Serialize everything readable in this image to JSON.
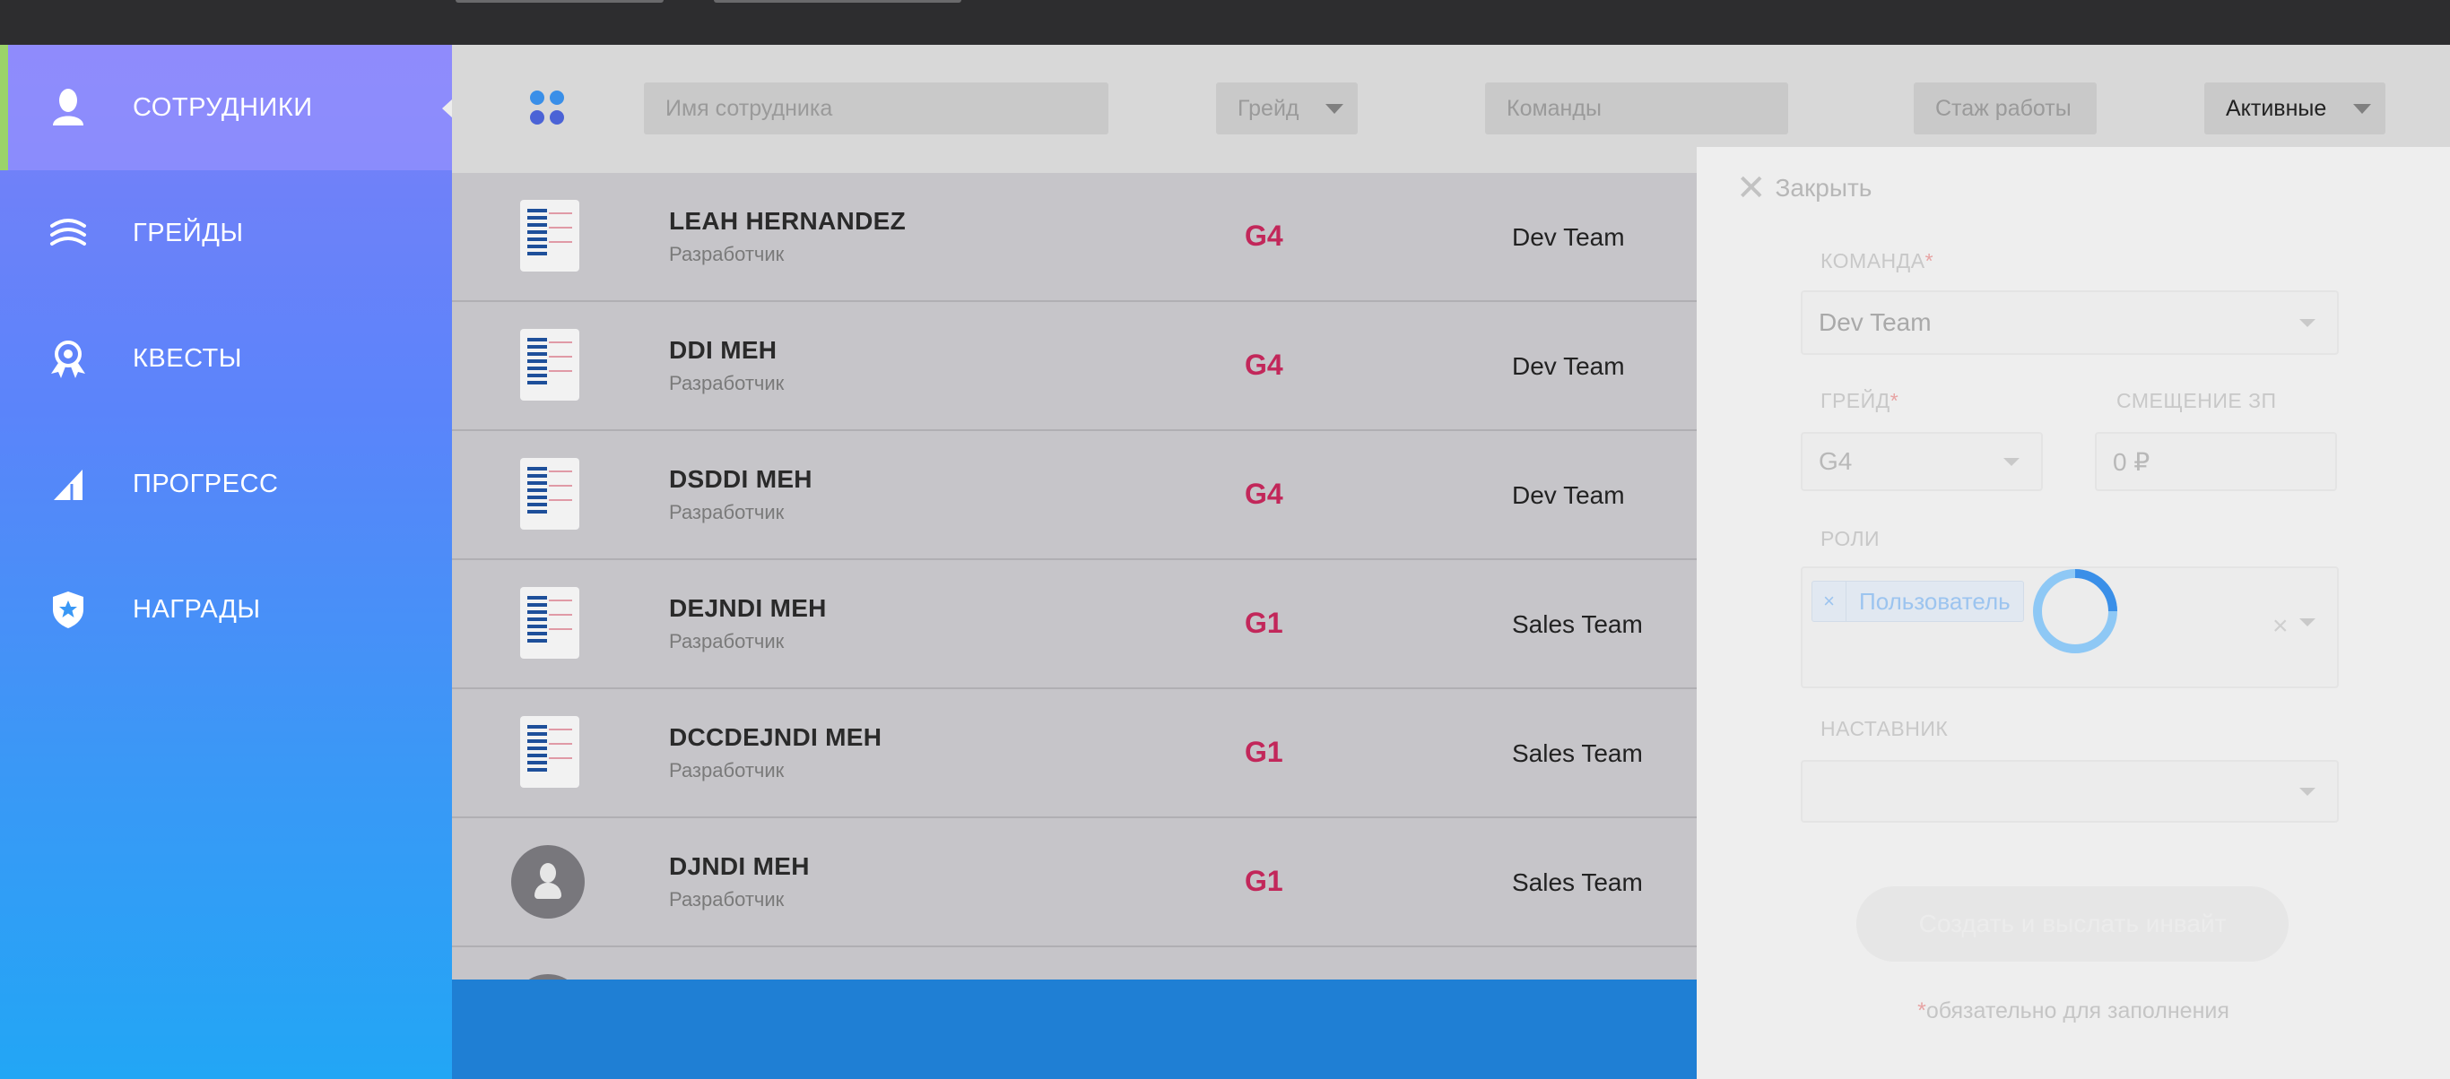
{
  "sidebar": {
    "items": [
      {
        "label": "СОТРУДНИКИ",
        "icon": "person-icon",
        "active": true
      },
      {
        "label": "ГРЕЙДЫ",
        "icon": "layers-icon",
        "active": false
      },
      {
        "label": "КВЕСТЫ",
        "icon": "medal-icon",
        "active": false
      },
      {
        "label": "ПРОГРЕСС",
        "icon": "signal-icon",
        "active": false
      },
      {
        "label": "НАГРАДЫ",
        "icon": "shield-star-icon",
        "active": false
      }
    ]
  },
  "filters": {
    "view_toggle_icon": "grid-dots-icon",
    "name_placeholder": "Имя сотрудника",
    "grade_label": "Грейд",
    "teams_placeholder": "Команды",
    "experience_label": "Стаж работы",
    "status_value": "Активные"
  },
  "employees": [
    {
      "name": "LEAH HERNANDEZ",
      "role": "Разработчик",
      "grade": "G4",
      "team": "Dev Team",
      "avatar": "document-thumbnail"
    },
    {
      "name": "DDI MEH",
      "role": "Разработчик",
      "grade": "G4",
      "team": "Dev Team",
      "avatar": "document-thumbnail"
    },
    {
      "name": "DSDDI MEH",
      "role": "Разработчик",
      "grade": "G4",
      "team": "Dev Team",
      "avatar": "document-thumbnail"
    },
    {
      "name": "DEJNDI MEH",
      "role": "Разработчик",
      "grade": "G1",
      "team": "Sales Team",
      "avatar": "document-thumbnail"
    },
    {
      "name": "DCCDEJNDI MEH",
      "role": "Разработчик",
      "grade": "G1",
      "team": "Sales Team",
      "avatar": "document-thumbnail"
    },
    {
      "name": "DJNDI MEH",
      "role": "Разработчик",
      "grade": "G1",
      "team": "Sales Team",
      "avatar": "person-placeholder"
    }
  ],
  "drawer": {
    "close_label": "Закрыть",
    "team_label": "КОМАНДА",
    "team_value": "Dev Team",
    "grade_label": "ГРЕЙД",
    "grade_value": "G4",
    "salary_offset_label": "СМЕЩЕНИЕ ЗП",
    "salary_offset_value": "0 ₽",
    "roles_label": "РОЛИ",
    "role_tag": "Пользователь",
    "role_tag_remove": "×",
    "roles_clear": "×",
    "mentor_label": "НАСТАВНИК",
    "mentor_value": "",
    "submit_label": "Создать и выслать инвайт",
    "required_mark": "*",
    "required_note": "обязательно для заполнения"
  },
  "colors": {
    "accent_active": "#9bd36a",
    "grade_color": "#c2275a",
    "spinner": "#4aa8ee"
  }
}
